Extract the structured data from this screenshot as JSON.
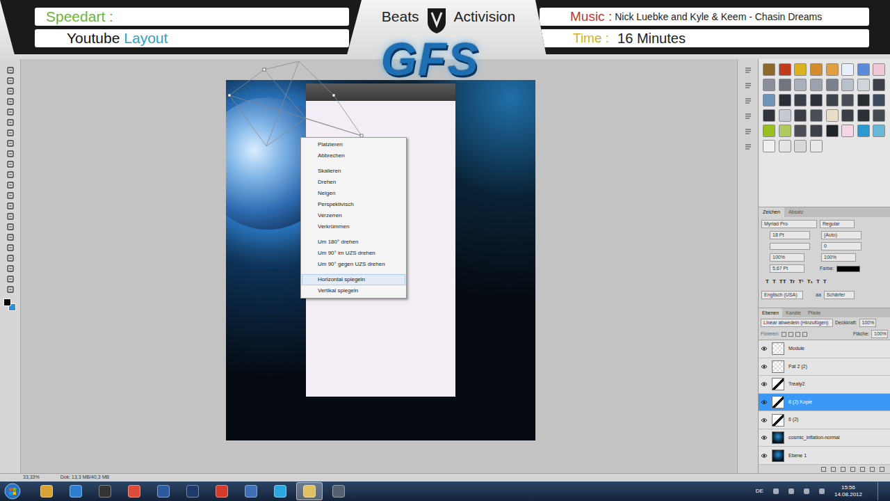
{
  "header": {
    "speedart_label": "Speedart :",
    "project_title": [
      "Youtube",
      "Layout"
    ],
    "brand_left": "Beats",
    "brand_right": "Activision",
    "music_label": "Music :",
    "music": "Nick Luebke and Kyle & Keem - Chasin Dreams",
    "time_label": "Time :",
    "time": "16 Minutes",
    "logo": "GFS"
  },
  "tools": {
    "foreground": "#000000",
    "background": "#2a8fd6"
  },
  "context_menu": {
    "groups": [
      [
        {
          "label": "Platzieren",
          "selected": false
        },
        {
          "label": "Abbrechen",
          "selected": false
        }
      ],
      [
        {
          "label": "Skalieren",
          "selected": false
        },
        {
          "label": "Drehen",
          "selected": false
        },
        {
          "label": "Neigen",
          "selected": false
        },
        {
          "label": "Perspektivisch",
          "selected": false
        },
        {
          "label": "Verzerren",
          "selected": false
        },
        {
          "label": "Verkrümmen",
          "selected": false
        }
      ],
      [
        {
          "label": "Um 180° drehen",
          "selected": false
        },
        {
          "label": "Um 90° im UZS drehen",
          "selected": false
        },
        {
          "label": "Um 90° gegen UZS drehen",
          "selected": false
        }
      ],
      [
        {
          "label": "Horizontal spiegeln",
          "selected": true
        },
        {
          "label": "Vertikal spiegeln",
          "selected": false
        }
      ]
    ]
  },
  "styles": [
    "#8d6a2c",
    "#c23a1e",
    "#d8b21f",
    "#d48b2e",
    "#e0a040",
    "#e8eefa",
    "#5b8ad8",
    "#f0c8d8",
    "#8a8f9a",
    "#6f7680",
    "#a8b0bc",
    "#9aa2ad",
    "#7a818c",
    "#b8c0ca",
    "#d0d5db",
    "#3c4048",
    "#6d93b8",
    "#2a2e36",
    "#3a3e46",
    "#2e3238",
    "#3f434b",
    "#4a4e56",
    "#2a2e34",
    "#3d4b5c",
    "#30353d",
    "#c4cad2",
    "#3a3f47",
    "#494e56",
    "#e8ddc8",
    "#3b4048",
    "#2b3037",
    "#444a52",
    "#9ac020",
    "#b0c860",
    "#4a4f57",
    "#3c4149",
    "#1f242b",
    "#f6d6e6",
    "#2a9ad0",
    "#6ab8d8",
    "#f0f0f0",
    "#e4e4e4",
    "#d8d8d8",
    "#e8e8e8"
  ],
  "character_panel": {
    "tabs": [
      {
        "label": "Zeichen",
        "selected": true
      },
      {
        "label": "Absatz",
        "selected": false
      }
    ],
    "font": "Myriad Pro",
    "style": "Regular",
    "size": "18 Pt",
    "leading": "(Auto)",
    "tracking": "0",
    "vertical_scale": "100%",
    "horizontal_scale": "100%",
    "baseline": "5,67 Pt",
    "color_label": "Farbe:",
    "color": "#000000",
    "type_buttons": [
      "T",
      "T",
      "TT",
      "Tr",
      "T¹",
      "T₁",
      "T",
      "T"
    ],
    "language": "Englisch (USA)",
    "aa_label": "aa",
    "antialias": "Schärfer"
  },
  "layers_panel": {
    "tabs": [
      {
        "label": "Ebenen",
        "selected": true
      },
      {
        "label": "Kanäle",
        "selected": false
      },
      {
        "label": "Pfade",
        "selected": false
      }
    ],
    "blend_mode": "Linear abwedeln (Hinzufügen)",
    "opacity_label": "Deckkraft:",
    "opacity": "100%",
    "lock_label": "Fixieren:",
    "fill_label": "Fläche:",
    "fill": "100%",
    "layers": [
      {
        "name": "Module",
        "visible": true,
        "selected": false,
        "kind": "transparent"
      },
      {
        "name": "Pat 2 (2)",
        "visible": true,
        "selected": false,
        "kind": "transparent"
      },
      {
        "name": "Treaty2",
        "visible": true,
        "selected": false,
        "kind": "shape"
      },
      {
        "name": "6 (2) Kopie",
        "visible": true,
        "selected": true,
        "kind": "shape"
      },
      {
        "name": "6 (2)",
        "visible": true,
        "selected": false,
        "kind": "shape"
      },
      {
        "name": "cosmic_inflation-normal",
        "visible": true,
        "selected": false,
        "kind": "image"
      },
      {
        "name": "Ebene 1",
        "visible": true,
        "selected": false,
        "kind": "image"
      }
    ]
  },
  "status_bar": {
    "zoom": "33,33%",
    "document": "Dok: 13,3 MB/40,3 MB"
  },
  "taskbar": {
    "apps": [
      {
        "color": "#d9a234",
        "selected": false
      },
      {
        "color": "#2f7fd0",
        "selected": false
      },
      {
        "color": "#333333",
        "selected": false
      },
      {
        "color": "#dd4b39",
        "selected": false
      },
      {
        "color": "#2c5aa0",
        "selected": false
      },
      {
        "color": "#1d3a6b",
        "selected": false
      },
      {
        "color": "#d43b2b",
        "selected": false
      },
      {
        "color": "#3f6fb5",
        "selected": false
      },
      {
        "color": "#2ba8e0",
        "selected": false
      },
      {
        "color": "#e0c060",
        "selected": true
      },
      {
        "color": "#556070",
        "selected": false
      }
    ],
    "language": "DE",
    "time": "15:56",
    "date": "14.08.2012"
  }
}
